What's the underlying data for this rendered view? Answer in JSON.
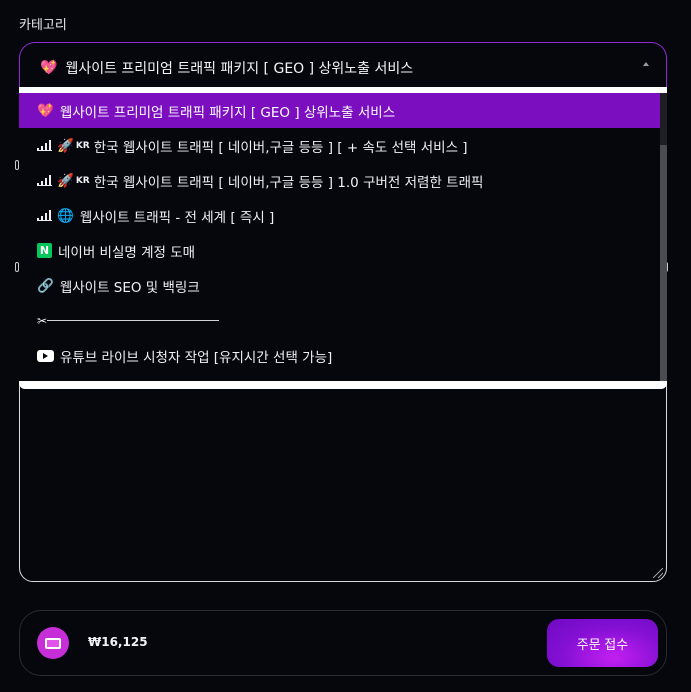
{
  "category_label": "카테고리",
  "select": {
    "selected_icon": "heart-sparkle-icon",
    "selected_text": "웹사이트 프리미엄 트래픽 패키지 [ GEO ] 상위노출 서비스"
  },
  "dropdown": {
    "options": [
      {
        "icon": "heart-sparkle-icon",
        "text": "웹사이트 프리미엄 트래픽 패키지 [ GEO ] 상위노출 서비스",
        "active": true
      },
      {
        "icon": "bars-rocket-kr-icon",
        "tag": "KR",
        "text": "한국 웹사이트 트래픽 [ 네이버,구글 등등 ] [ + 속도 선택 서비스 ]"
      },
      {
        "icon": "bars-rocket-kr-icon",
        "tag": "KR",
        "text": "한국 웹사이트 트래픽 [ 네이버,구글 등등 ] 1.0 구버전 저렴한 트래픽"
      },
      {
        "icon": "bars-globe-icon",
        "text": "웹사이트 트래픽 - 전 세계 [ 즉시 ]"
      },
      {
        "icon": "naver-n-icon",
        "text": "네이버 비실명 계정 도매"
      },
      {
        "icon": "link-icon",
        "text": "웹사이트 SEO 및 백링크"
      },
      {
        "icon": "scissors-icon",
        "text": ""
      },
      {
        "icon": "youtube-icon",
        "text": "유튜브 라이브 시청자 작업 [유지시간 선택 가능]"
      }
    ]
  },
  "order": {
    "price": "₩16,125",
    "submit_label": "주문 접수"
  },
  "colors": {
    "accent": "#7b0fc0",
    "background": "#05070d",
    "naver": "#03c75a"
  }
}
